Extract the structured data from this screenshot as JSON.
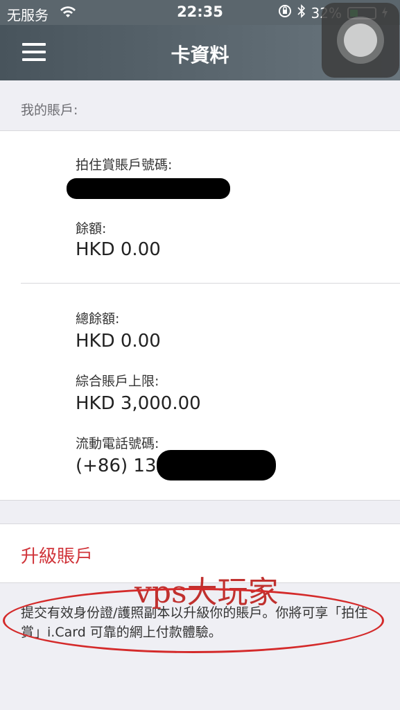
{
  "status_bar": {
    "carrier": "无服务",
    "time": "22:35",
    "battery": "32%",
    "battery_level": 0.32
  },
  "nav": {
    "title": "卡資料"
  },
  "account": {
    "section_header": "我的賬戶:",
    "account_number_label": "拍住賞賬戶號碼:",
    "balance_label": "餘額:",
    "balance_value": "HKD 0.00",
    "total_balance_label": "總餘額:",
    "total_balance_value": "HKD 0.00",
    "limit_label": "綜合賬戶上限:",
    "limit_value": "HKD 3,000.00",
    "phone_label": "流動電話號碼:",
    "phone_value": "(+86) 132"
  },
  "upgrade": {
    "label": "升級賬戶",
    "note": "提交有效身份證/護照副本以升級你的賬戶。你將可享「拍住賞」i.Card 可靠的網上付款體驗。"
  },
  "watermark": "vps大玩家",
  "colors": {
    "accent_red": "#d0343a",
    "battery_green": "#4cd964"
  }
}
